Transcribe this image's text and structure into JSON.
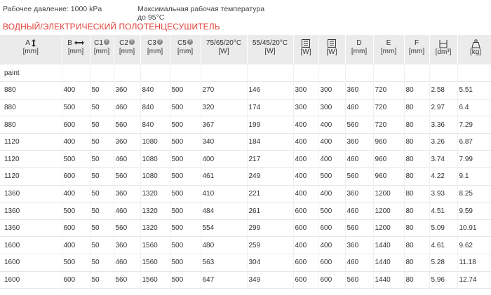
{
  "info": {
    "pressure": "Рабочее давление: 1000 kPa",
    "max_temp": "Максимальная рабочая температура до 95°C"
  },
  "title": "ВОДНЫЙ/ЭЛЕКТРИЧЕСКИЙ ПОЛОТЕНЦЕСУШИТЕЛЬ",
  "headers": {
    "a": "A",
    "a_unit": "[mm]",
    "b": "B",
    "b_unit": "[mm]",
    "c1": "C1",
    "c1_unit": "[mm]",
    "c2": "C2",
    "c2_unit": "[mm]",
    "c3": "C3",
    "c3_unit": "[mm]",
    "c5": "C5",
    "c5_unit": "[mm]",
    "p75": "75/65/20°C",
    "p75_unit": "[W]",
    "p55": "55/45/20°C",
    "p55_unit": "[W]",
    "e1_unit": "[W]",
    "e2_unit": "[W]",
    "d": "D",
    "d_unit": "[mm]",
    "e": "E",
    "e_unit": "[mm]",
    "f": "F",
    "f_unit": "[mm]",
    "vol_unit": "[dm³]",
    "wt_unit": "[kg]"
  },
  "paint_label": "paint",
  "rows": [
    [
      "880",
      "400",
      "50",
      "360",
      "840",
      "500",
      "270",
      "146",
      "300",
      "300",
      "360",
      "720",
      "80",
      "2.58",
      "5.51"
    ],
    [
      "880",
      "500",
      "50",
      "460",
      "840",
      "500",
      "320",
      "174",
      "300",
      "300",
      "460",
      "720",
      "80",
      "2.97",
      "6.4"
    ],
    [
      "880",
      "600",
      "50",
      "560",
      "840",
      "500",
      "367",
      "199",
      "400",
      "400",
      "560",
      "720",
      "80",
      "3.36",
      "7.29"
    ],
    [
      "1120",
      "400",
      "50",
      "360",
      "1080",
      "500",
      "340",
      "184",
      "400",
      "400",
      "360",
      "960",
      "80",
      "3.26",
      "6.87"
    ],
    [
      "1120",
      "500",
      "50",
      "460",
      "1080",
      "500",
      "400",
      "217",
      "400",
      "400",
      "460",
      "960",
      "80",
      "3.74",
      "7.99"
    ],
    [
      "1120",
      "600",
      "50",
      "560",
      "1080",
      "500",
      "461",
      "249",
      "400",
      "500",
      "560",
      "960",
      "80",
      "4.22",
      "9.1"
    ],
    [
      "1360",
      "400",
      "50",
      "360",
      "1320",
      "500",
      "410",
      "221",
      "400",
      "400",
      "360",
      "1200",
      "80",
      "3.93",
      "8.25"
    ],
    [
      "1360",
      "500",
      "50",
      "460",
      "1320",
      "500",
      "484",
      "261",
      "600",
      "500",
      "460",
      "1200",
      "80",
      "4.51",
      "9.59"
    ],
    [
      "1360",
      "600",
      "50",
      "560",
      "1320",
      "500",
      "554",
      "299",
      "600",
      "600",
      "560",
      "1200",
      "80",
      "5.09",
      "10.91"
    ],
    [
      "1600",
      "400",
      "50",
      "360",
      "1560",
      "500",
      "480",
      "259",
      "400",
      "400",
      "360",
      "1440",
      "80",
      "4.61",
      "9.62"
    ],
    [
      "1600",
      "500",
      "50",
      "460",
      "1560",
      "500",
      "563",
      "304",
      "600",
      "600",
      "460",
      "1440",
      "80",
      "5.28",
      "11.18"
    ],
    [
      "1600",
      "600",
      "50",
      "560",
      "1560",
      "500",
      "647",
      "349",
      "600",
      "600",
      "560",
      "1440",
      "80",
      "5.96",
      "12.74"
    ]
  ]
}
